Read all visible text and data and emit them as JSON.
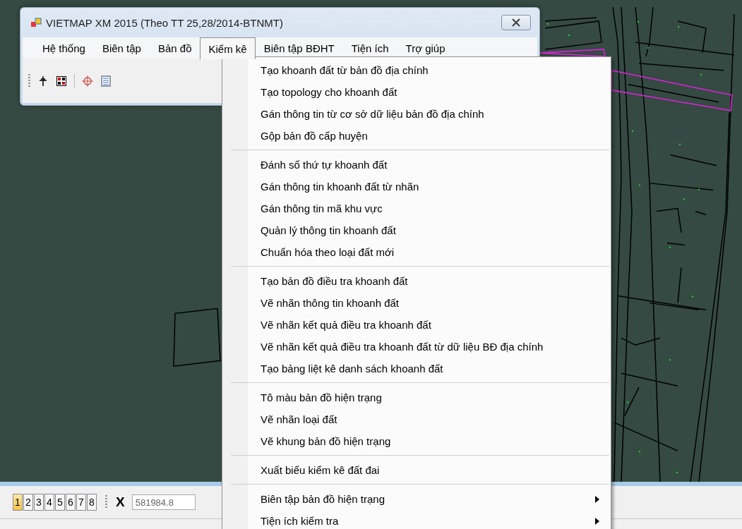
{
  "window": {
    "title": "VIETMAP XM 2015 (Theo TT 25,28/2014-BTNMT)"
  },
  "menu_bar": [
    {
      "label": "Hệ thống",
      "selected": false
    },
    {
      "label": "Biên tập",
      "selected": false
    },
    {
      "label": "Bản đồ",
      "selected": false
    },
    {
      "label": "Kiểm kê",
      "selected": true
    },
    {
      "label": "Biên tập BĐHT",
      "selected": false
    },
    {
      "label": "Tiện ích",
      "selected": false
    },
    {
      "label": "Trợ giúp",
      "selected": false
    }
  ],
  "dropdown": {
    "groups": [
      [
        {
          "label": "Tạo khoanh đất từ bản đồ địa chính",
          "has_submenu": false
        },
        {
          "label": "Tạo topology cho khoanh đất",
          "has_submenu": false
        },
        {
          "label": "Gán thông tin từ cơ sở dữ liệu bản đồ địa chính",
          "has_submenu": false
        },
        {
          "label": "Gộp bản đồ cấp huyện",
          "has_submenu": false
        }
      ],
      [
        {
          "label": "Đánh số thứ tự khoanh đất",
          "has_submenu": false
        },
        {
          "label": "Gán thông tin khoanh đất từ nhãn",
          "has_submenu": false
        },
        {
          "label": "Gán thông tin mã khu vực",
          "has_submenu": false
        },
        {
          "label": "Quản lý thông tin khoanh đất",
          "has_submenu": false
        },
        {
          "label": "Chuẩn hóa theo loại đất mới",
          "has_submenu": false
        }
      ],
      [
        {
          "label": "Tạo bản đồ điều tra khoanh đất",
          "has_submenu": false
        },
        {
          "label": "Vẽ nhãn thông tin khoanh đất",
          "has_submenu": false
        },
        {
          "label": "Vẽ nhãn kết quả điều tra khoanh đất",
          "has_submenu": false
        },
        {
          "label": "Vẽ nhãn kết quả điều tra khoanh đất từ dữ liệu BĐ địa chính",
          "has_submenu": false
        },
        {
          "label": "Tạo bảng liệt kê danh sách khoanh đất",
          "has_submenu": false
        }
      ],
      [
        {
          "label": "Tô màu bản đồ hiện trạng",
          "has_submenu": false
        },
        {
          "label": "Vẽ nhãn loại đất",
          "has_submenu": false
        },
        {
          "label": "Vẽ khung bản đồ hiện trạng",
          "has_submenu": false
        }
      ],
      [
        {
          "label": "Xuất biểu kiểm kê đất đai",
          "has_submenu": false
        }
      ],
      [
        {
          "label": "Biên tập bản đồ hiện trạng",
          "has_submenu": true
        },
        {
          "label": "Tiện ích kiểm tra",
          "has_submenu": true
        }
      ]
    ]
  },
  "page_buttons": [
    {
      "label": "1",
      "selected": true
    },
    {
      "label": "2",
      "selected": false
    },
    {
      "label": "3",
      "selected": false
    },
    {
      "label": "4",
      "selected": false
    },
    {
      "label": "5",
      "selected": false
    },
    {
      "label": "6",
      "selected": false
    },
    {
      "label": "7",
      "selected": false
    },
    {
      "label": "8",
      "selected": false
    }
  ],
  "coordinates": {
    "label": "X",
    "value": "581984.8"
  }
}
